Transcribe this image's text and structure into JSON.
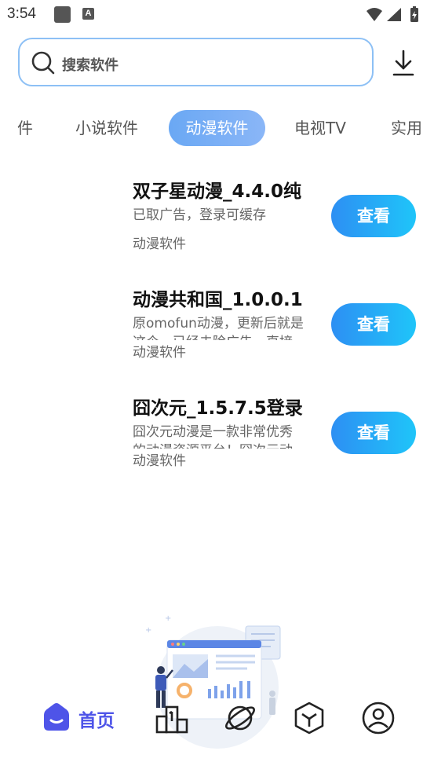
{
  "status_bar": {
    "time": "3:54",
    "notification_icon_letter": "A"
  },
  "search": {
    "placeholder": "搜索软件"
  },
  "tabs": [
    {
      "label": "件"
    },
    {
      "label": "小说软件"
    },
    {
      "label": "动漫软件",
      "active": true
    },
    {
      "label": "电视TV"
    },
    {
      "label": "实用"
    }
  ],
  "apps": [
    {
      "name": "双子星动漫_4.4.0纯",
      "description": "已取广告，登录可缓存",
      "description_line2": "",
      "category": "动漫软件",
      "button_label": "查看"
    },
    {
      "name": "动漫共和国_1.0.0.1",
      "description": "原omofun动漫，更新后就是",
      "description_line2": "这个，已经去除广告，直接",
      "category": "动漫软件",
      "button_label": "查看"
    },
    {
      "name": "囧次元_1.5.7.5登录",
      "description": "囧次元动漫是一款非常优秀",
      "description_line2": "的动漫资源平台！囧次元动",
      "category": "动漫软件",
      "button_label": "查看"
    }
  ],
  "bottom_nav": {
    "items": [
      {
        "label": "首页",
        "icon": "home-icon",
        "active": true
      },
      {
        "label": "",
        "icon": "ranking-icon"
      },
      {
        "label": "",
        "icon": "planet-icon"
      },
      {
        "label": "",
        "icon": "cube-icon"
      },
      {
        "label": "",
        "icon": "profile-icon"
      }
    ]
  },
  "colors": {
    "accent": "#4e54e8",
    "button_start": "#2d8ff3",
    "button_end": "#1fc5f9",
    "tab_active": "#6aa8f4",
    "search_border": "#8dc0f5"
  }
}
